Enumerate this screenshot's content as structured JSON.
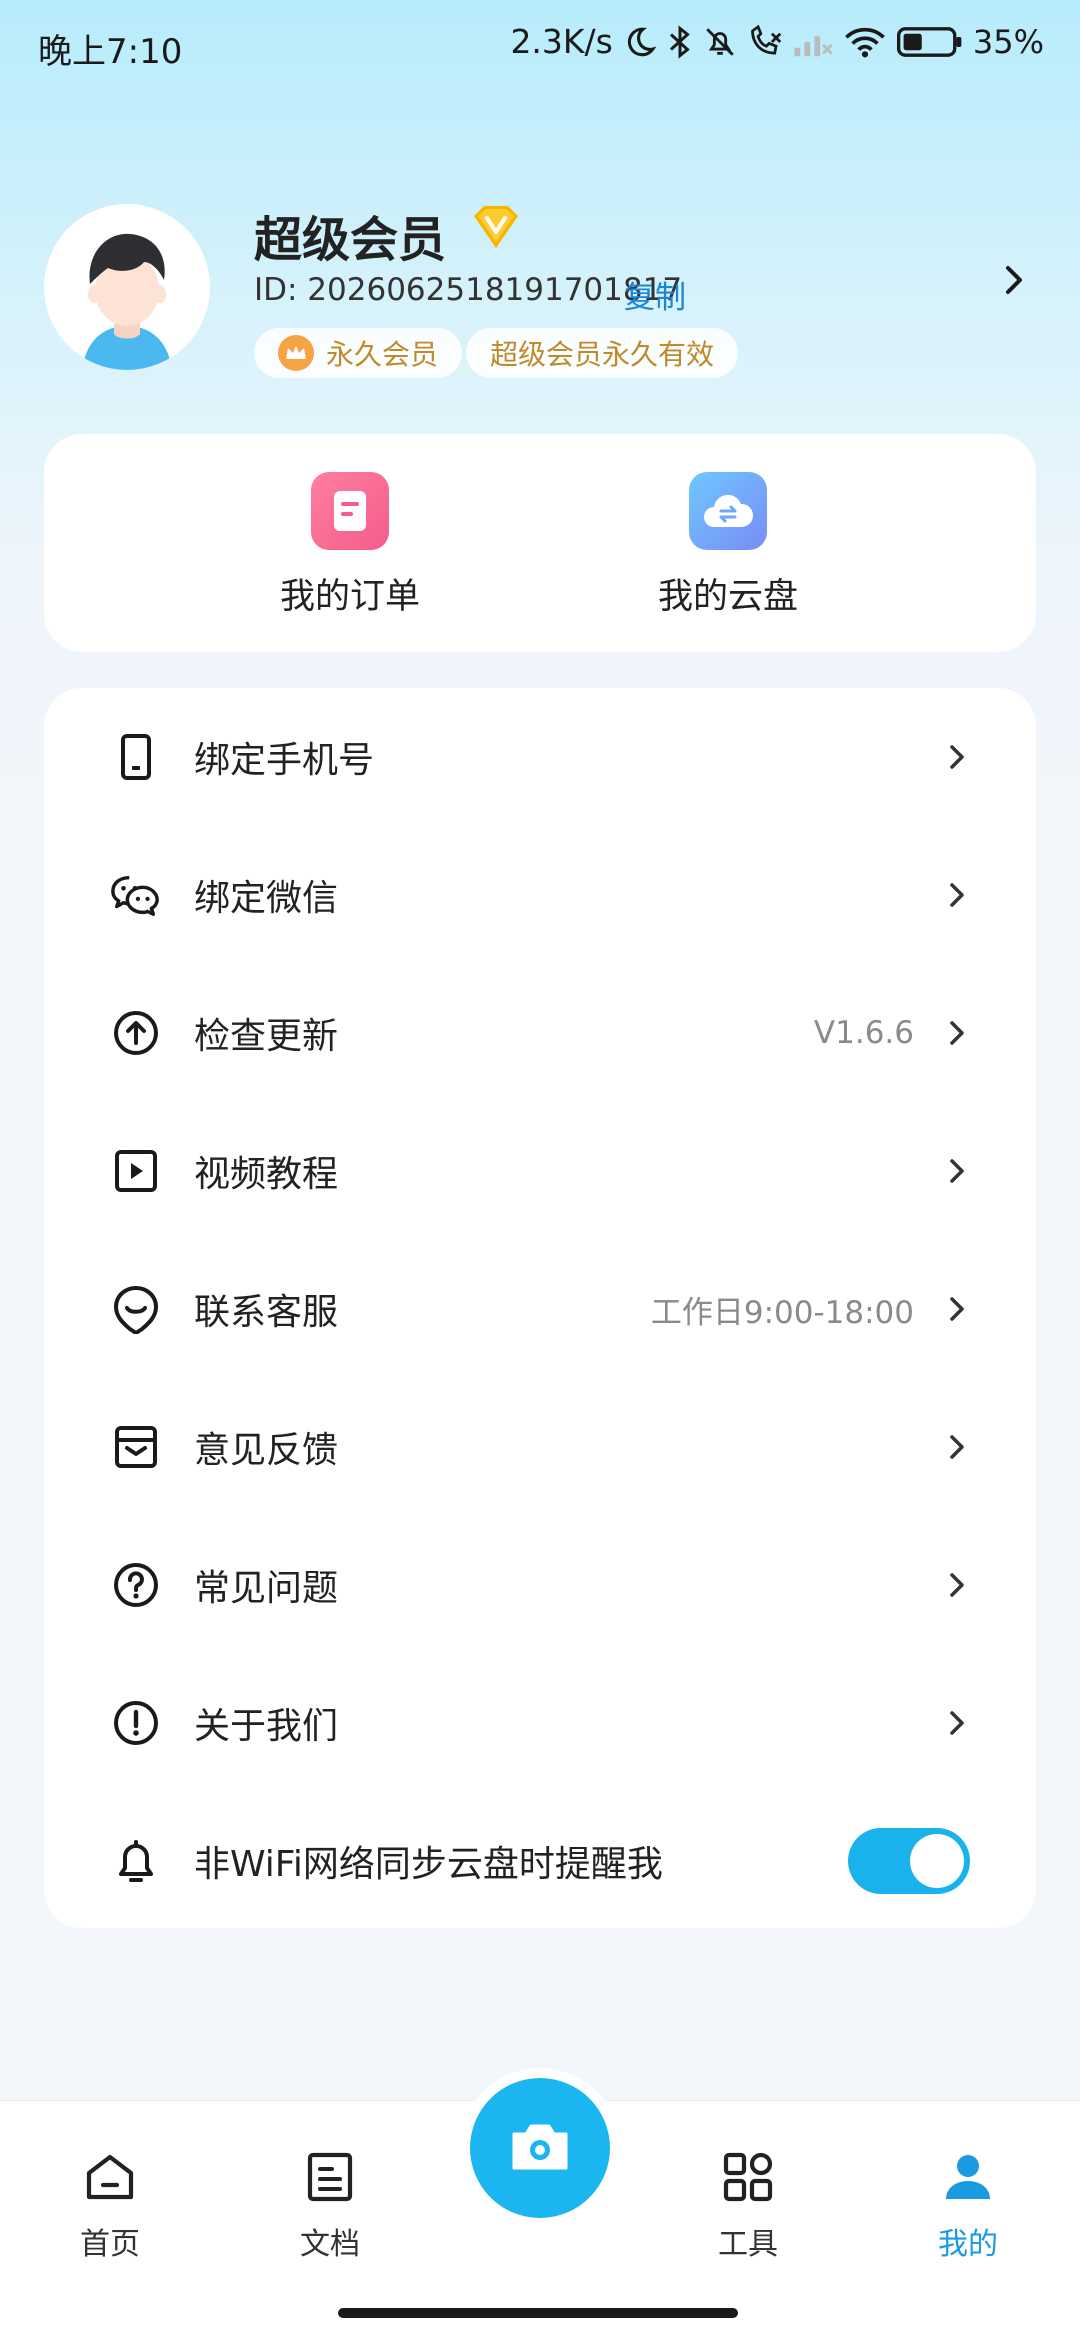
{
  "status_bar": {
    "time": "晚上7:10",
    "network_speed": "2.3K/s",
    "battery": "35%",
    "icons": [
      "moon-icon",
      "bluetooth-icon",
      "mute-icon",
      "call-icon",
      "signal-icon",
      "wifi-icon",
      "battery-icon"
    ]
  },
  "profile": {
    "name": "超级会员",
    "id_text": "ID: 2026062518191701817",
    "copy_label": "复制",
    "tag_permanent": "永久会员",
    "tag_validity": "超级会员永久有效"
  },
  "quick_actions": {
    "orders_label": "我的订单",
    "cloud_label": "我的云盘"
  },
  "menu": {
    "bind_phone": "绑定手机号",
    "bind_wechat": "绑定微信",
    "check_update": "检查更新",
    "version": "V1.6.6",
    "video_tutorial": "视频教程",
    "contact_service": "联系客服",
    "service_hours": "工作日9:00-18:00",
    "feedback": "意见反馈",
    "faq": "常见问题",
    "about": "关于我们",
    "wifi_remind": "非WiFi网络同步云盘时提醒我",
    "wifi_remind_on": true
  },
  "tabbar": {
    "home": "首页",
    "docs": "文档",
    "tools": "工具",
    "mine": "我的",
    "active": "mine"
  },
  "colors": {
    "accent": "#1ab2ec",
    "link": "#1a86d8",
    "tag_text": "#c08a2b"
  }
}
